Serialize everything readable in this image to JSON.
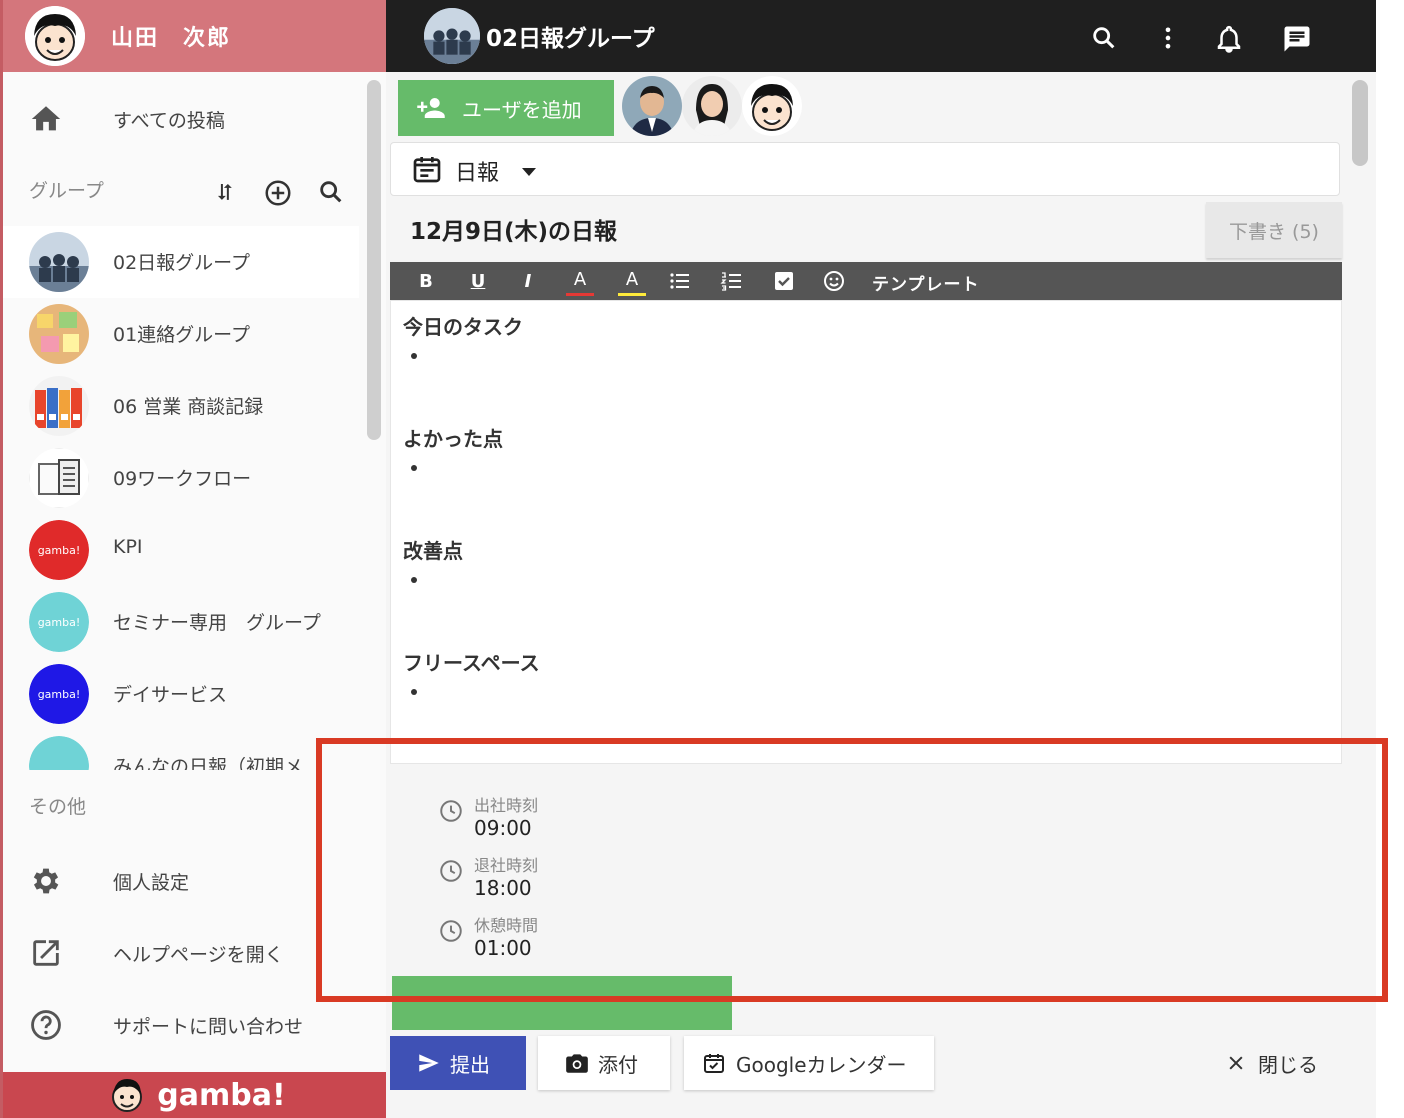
{
  "user": {
    "name": "山田　次郎"
  },
  "nav": {
    "all_posts": "すべての投稿"
  },
  "groups": {
    "label": "グループ",
    "items": [
      {
        "label": "02日報グループ"
      },
      {
        "label": "01連絡グループ"
      },
      {
        "label": "06 営業 商談記録"
      },
      {
        "label": "09ワークフロー"
      },
      {
        "label": "KPI"
      },
      {
        "label": "セミナー専用　グループ"
      },
      {
        "label": "デイサービス"
      },
      {
        "label": "みんなの日報（初期メ"
      }
    ]
  },
  "other": {
    "label": "その他",
    "personal_settings": "個人設定",
    "help_page": "ヘルプページを開く",
    "support": "サポートに問い合わせ"
  },
  "brand": "gamba!",
  "topbar": {
    "title": "02日報グループ"
  },
  "main": {
    "add_user": "ユーザを追加",
    "report_type": "日報",
    "report_title": "12月9日(木)の日報",
    "draft_button": "下書き (5)",
    "toolbar": {
      "bold": "B",
      "underline": "U",
      "italic": "I",
      "font_color": "A",
      "highlight": "A",
      "template": "テンプレート"
    },
    "sections": [
      "今日のタスク",
      "よかった点",
      "改善点",
      "フリースペース"
    ],
    "times": [
      {
        "label": "出社時刻",
        "value": "09:00"
      },
      {
        "label": "退社時刻",
        "value": "18:00"
      },
      {
        "label": "休憩時間",
        "value": "01:00"
      }
    ],
    "actions": {
      "submit": "提出",
      "attach": "添付",
      "google_calendar": "Googleカレンダー",
      "close": "閉じる"
    }
  },
  "colors": {
    "header_sidebar": "#d4767c",
    "footer": "#c9474f",
    "green": "#66bb6a",
    "submit": "#3f51b5",
    "highlight_box": "#d93a24"
  }
}
